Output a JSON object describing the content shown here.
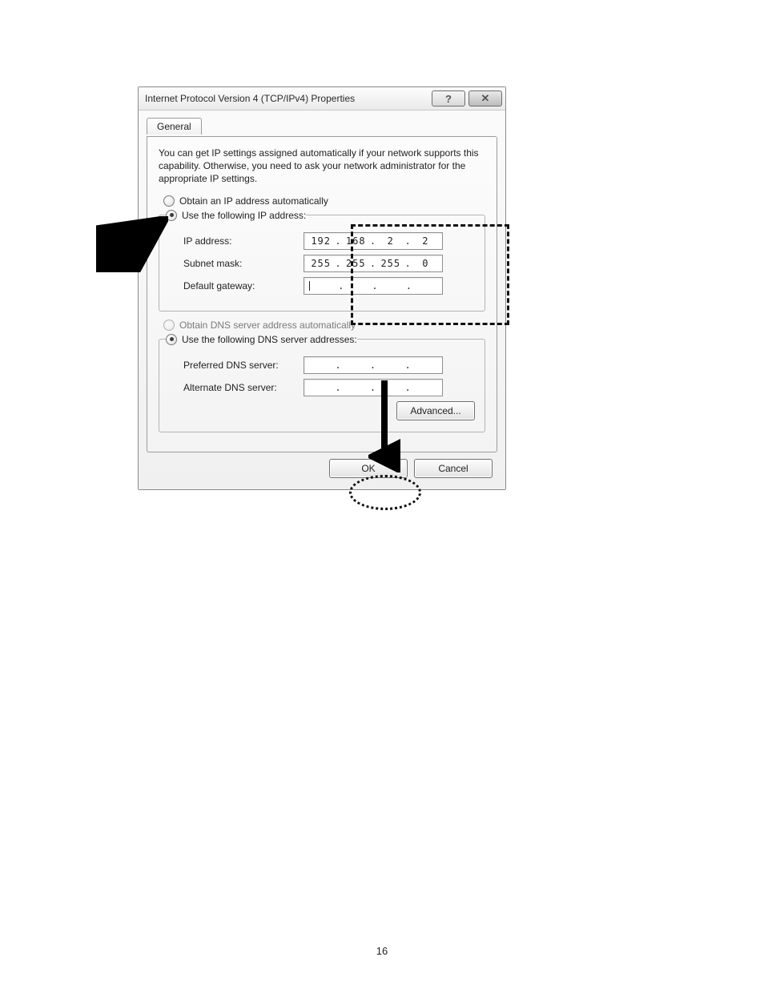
{
  "page_number": "16",
  "dialog": {
    "title": "Internet Protocol Version 4 (TCP/IPv4) Properties",
    "help_icon": "?",
    "close_icon": "✕",
    "tab_label": "General",
    "description": "You can get IP settings assigned automatically if your network supports this capability. Otherwise, you need to ask your network administrator for the appropriate IP settings.",
    "ip_section": {
      "opt_auto": "Obtain an IP address automatically",
      "opt_manual": "Use the following IP address:",
      "ip_label": "IP address:",
      "ip_value": [
        "192",
        "168",
        "2",
        "2"
      ],
      "subnet_label": "Subnet mask:",
      "subnet_value": [
        "255",
        "255",
        "255",
        "0"
      ],
      "gateway_label": "Default gateway:",
      "gateway_value": [
        "",
        "",
        "",
        ""
      ]
    },
    "dns_section": {
      "opt_auto": "Obtain DNS server address automatically",
      "opt_manual": "Use the following DNS server addresses:",
      "pref_label": "Preferred DNS server:",
      "pref_value": [
        "",
        "",
        "",
        ""
      ],
      "alt_label": "Alternate DNS server:",
      "alt_value": [
        "",
        "",
        "",
        ""
      ]
    },
    "advanced_btn": "Advanced...",
    "ok_btn": "OK",
    "cancel_btn": "Cancel"
  }
}
